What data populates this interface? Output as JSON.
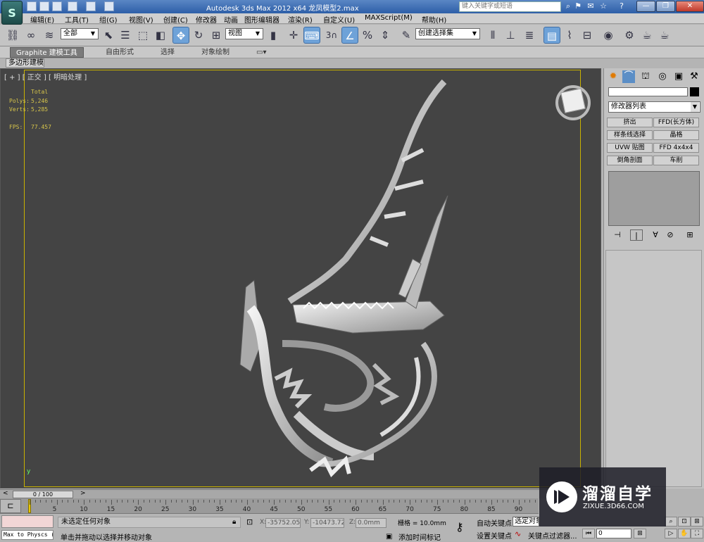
{
  "title_bar": {
    "window_title": "Autodesk 3ds Max  2012 x64      龙凤模型2.max",
    "search_placeholder": "键入关键字或短语",
    "minimize": "—",
    "maximize": "❐",
    "close": "✕"
  },
  "menu": {
    "items": [
      "编辑(E)",
      "工具(T)",
      "组(G)",
      "视图(V)",
      "创建(C)",
      "修改器",
      "动画",
      "图形编辑器",
      "渲染(R)",
      "自定义(U)",
      "MAXScript(M)",
      "帮助(H)"
    ]
  },
  "toolbar": {
    "selection_filter": "全部",
    "ref_coord": "视图",
    "named_selection": "创建选择集",
    "snap_label": "3"
  },
  "ribbon": {
    "tabs": [
      "Graphite 建模工具",
      "自由形式",
      "选择",
      "对象绘制"
    ],
    "active_tab": "Graphite 建模工具",
    "sub_tab": "多边形建模"
  },
  "viewport": {
    "label": "[ + ] [ 正交 ] [ 明暗处理 ]",
    "stats": {
      "header": "Total",
      "polys_label": "Polys:",
      "polys": "5,246",
      "verts_label": "Verts:",
      "verts": "5,285",
      "fps_label": "FPS:",
      "fps": "77.457"
    },
    "axis_label": "y"
  },
  "command_panel": {
    "modifier_list": "修改器列表",
    "modifier_buttons": [
      "挤出",
      "FFD(长方体)",
      "样条线选择",
      "晶格",
      "UVW 贴图",
      "FFD 4x4x4",
      "倒角剖面",
      "车削"
    ]
  },
  "timeline": {
    "frame_display": "0 / 100",
    "ticks": [
      "0",
      "5",
      "10",
      "15",
      "20",
      "25",
      "30",
      "35",
      "40",
      "45",
      "50",
      "55",
      "60",
      "65",
      "70",
      "75",
      "80",
      "85",
      "90"
    ],
    "prev": "<",
    "next": ">"
  },
  "status": {
    "listener_text": "Max to Physcs (",
    "selection_status": "未选定任何对象",
    "prompt": "单击并拖动以选择并移动对象",
    "x_label": "X:",
    "x_value": "-35752.055",
    "y_label": "Y:",
    "y_value": "-10473.726",
    "z_label": "Z:",
    "z_value": "0.0mm",
    "grid": "栅格 = 10.0mm",
    "add_time_tag": "添加时间标记",
    "auto_key": "自动关键点",
    "auto_key_target": "选定对象",
    "set_key": "设置关键点",
    "key_filters": "关键点过滤器...",
    "current_frame": "0"
  },
  "watermark": {
    "title": "溜溜自学",
    "url": "ZIXUE.3D66.COM"
  },
  "colors": {
    "viewport_bg": "#444444",
    "viewport_border": "#c9b200",
    "stats_text": "#d6c44a",
    "active_tool": "#6ea2d8",
    "title_bar": "#2d5fa8"
  }
}
